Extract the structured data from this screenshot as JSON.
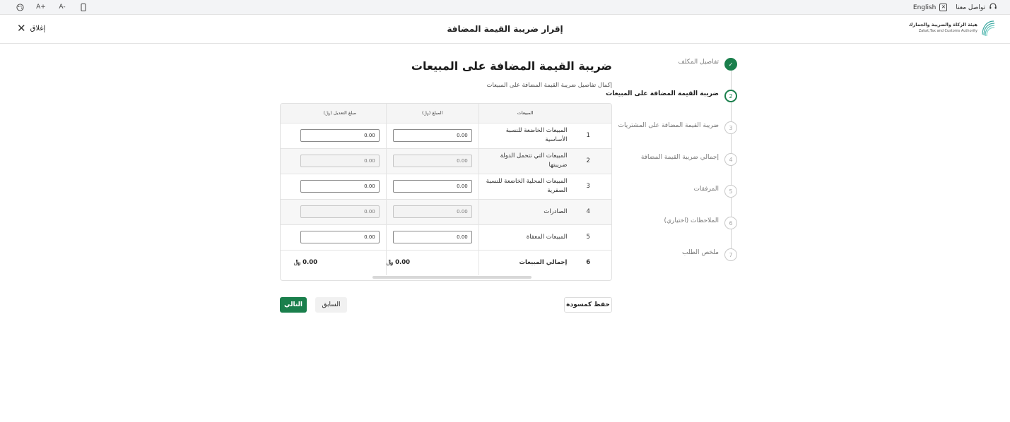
{
  "utility_bar": {
    "language": "English",
    "contact": "تواصل معنا",
    "font_small": "A-",
    "font_large": "A+"
  },
  "header": {
    "title": "إقرار ضريبة القيمة المضافة",
    "close_label": "إغلاق",
    "logo_ar": "هيئة الزكاة والضريبة والجمارك",
    "logo_en": "Zakat,Tax and Customs Authority"
  },
  "stepper": {
    "steps": [
      {
        "num": "✓",
        "label": "تفاصيل المكلف",
        "state": "done"
      },
      {
        "num": "2",
        "label": "ضريبة القيمة المضافة على المبيعات",
        "state": "active"
      },
      {
        "num": "3",
        "label": "ضريبة القيمة المضافة على المشتريات",
        "state": "pending"
      },
      {
        "num": "4",
        "label": "إجمالي ضريبة القيمة المضافة",
        "state": "pending"
      },
      {
        "num": "5",
        "label": "المرفقات",
        "state": "pending"
      },
      {
        "num": "6",
        "label": "الملاحظات (اختياري)",
        "state": "pending"
      },
      {
        "num": "7",
        "label": "ملخص الطلب",
        "state": "pending"
      }
    ]
  },
  "main": {
    "title": "ضريبة القيمة المضافة على المبيعات",
    "description": "إكمال تفاصيل ضريبة القيمة المضافة على المبيعات"
  },
  "table": {
    "headers": {
      "desc": "المبيعات",
      "amount": "المبلغ (﷼)",
      "adjustment": "مبلغ التعديل (﷼)"
    },
    "rows": [
      {
        "idx": "1",
        "desc": "المبيعات الخاضعة للنسبة الأساسية",
        "amount": "0.00",
        "adjustment": "0.00",
        "disabled": false
      },
      {
        "idx": "2",
        "desc": "المبيعات التي تتحمل الدولة ضريبتها",
        "amount": "0.00",
        "adjustment": "0.00",
        "disabled": true
      },
      {
        "idx": "3",
        "desc": "المبيعات المحلية الخاضعة للنسبة الصفرية",
        "amount": "0.00",
        "adjustment": "0.00",
        "disabled": false
      },
      {
        "idx": "4",
        "desc": "الصادرات",
        "amount": "0.00",
        "adjustment": "0.00",
        "disabled": true
      },
      {
        "idx": "5",
        "desc": "المبيعات المعفاة",
        "amount": "0.00",
        "adjustment": "0.00",
        "disabled": false
      }
    ],
    "total": {
      "idx": "6",
      "label": "إجمالي المبيعات",
      "amount": "0.00 ﷼",
      "adjustment": "0.00 ﷼"
    }
  },
  "buttons": {
    "next": "التالي",
    "previous": "السابق",
    "save_draft": "حفظ كمسودة"
  }
}
